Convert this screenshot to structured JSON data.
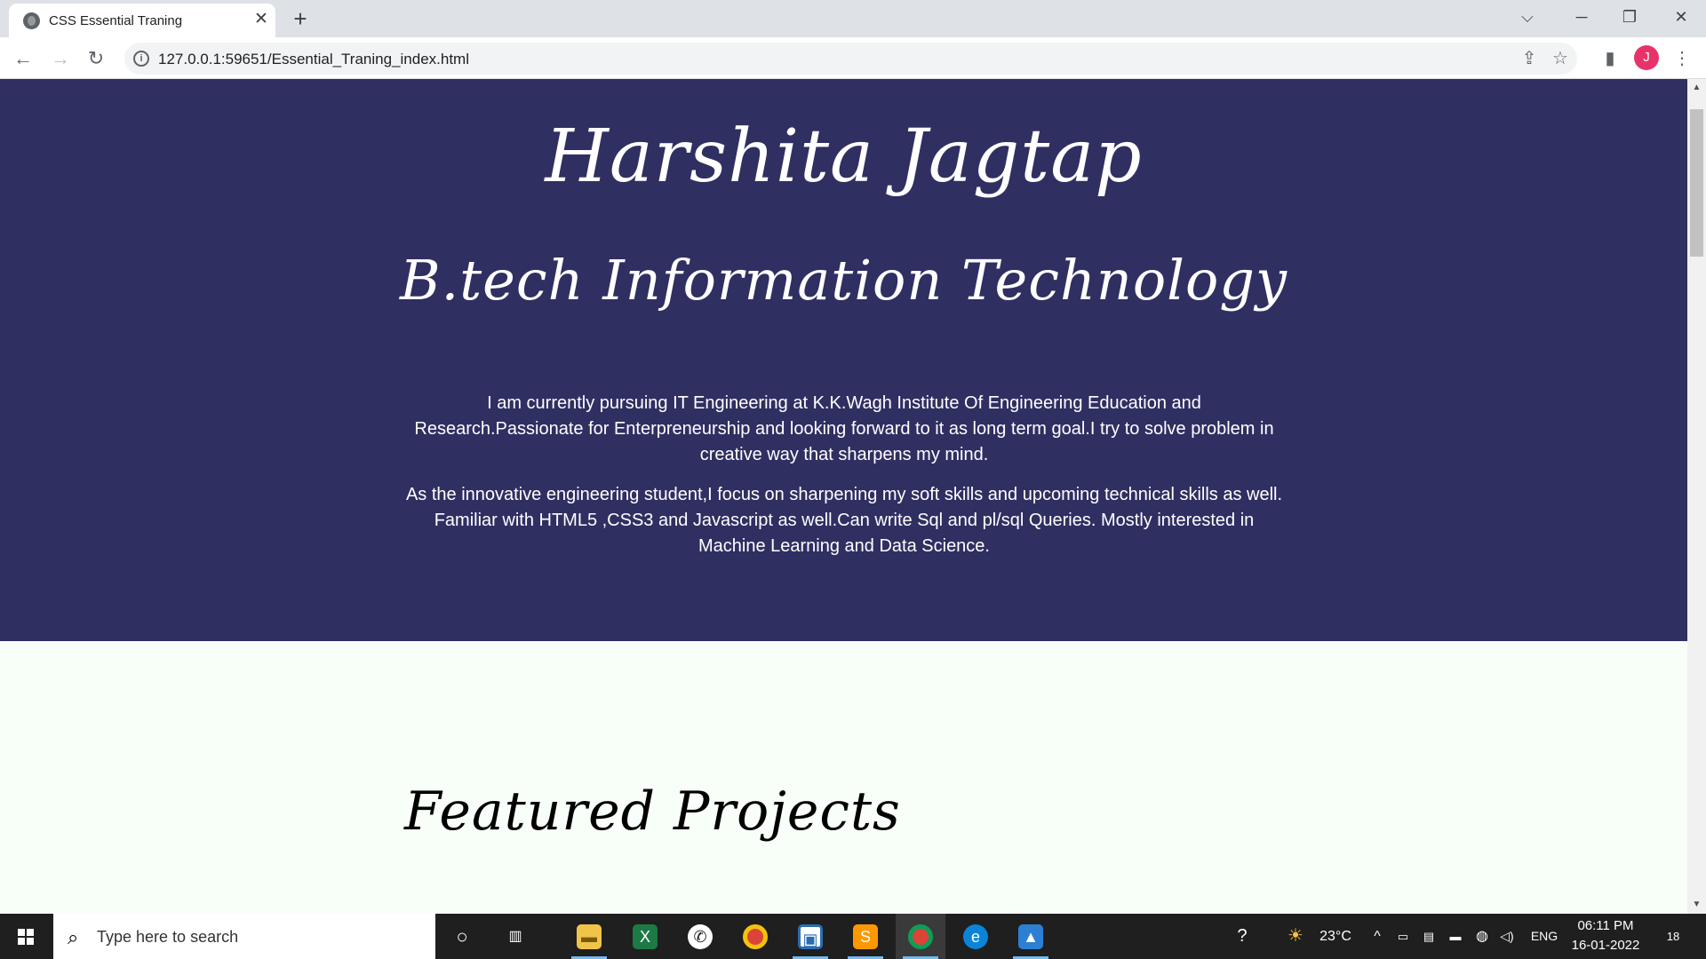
{
  "browser": {
    "tab_title": "CSS Essential Traning",
    "tab_close": "✕",
    "new_tab": "+",
    "url": "127.0.0.1:59651/Essential_Traning_index.html",
    "profile_initial": "J"
  },
  "page": {
    "name": "Harshita Jagtap",
    "degree": "B.tech Information Technology",
    "paragraphs": [
      "I am currently pursuing IT Engineering at K.K.Wagh Institute Of Engineering Education and Research.Passionate for Enterpreneurship and looking forward to it as long term goal.I try to solve problem in creative way that sharpens my mind.",
      "As the innovative engineering student,I focus on sharpening my soft skills and upcoming technical skills as well. Familiar with HTML5 ,CSS3 and Javascript as well.Can write Sql and pl/sql Queries. Mostly interested in Machine Learning and Data Science."
    ],
    "section_title": "Featured Projects",
    "colors": {
      "hero_bg": "#302f62",
      "page_bg": "#f8fff8",
      "hero_text": "#ffffff"
    }
  },
  "taskbar": {
    "search_placeholder": "Type here to search",
    "weather_temp": "23°C",
    "language": "ENG",
    "time": "06:11 PM",
    "date": "16-01-2022",
    "notification_count": "18",
    "apps": [
      "file-explorer",
      "excel",
      "whatsapp",
      "chrome",
      "app-square",
      "sublime-text",
      "chrome",
      "edge",
      "photos"
    ]
  }
}
